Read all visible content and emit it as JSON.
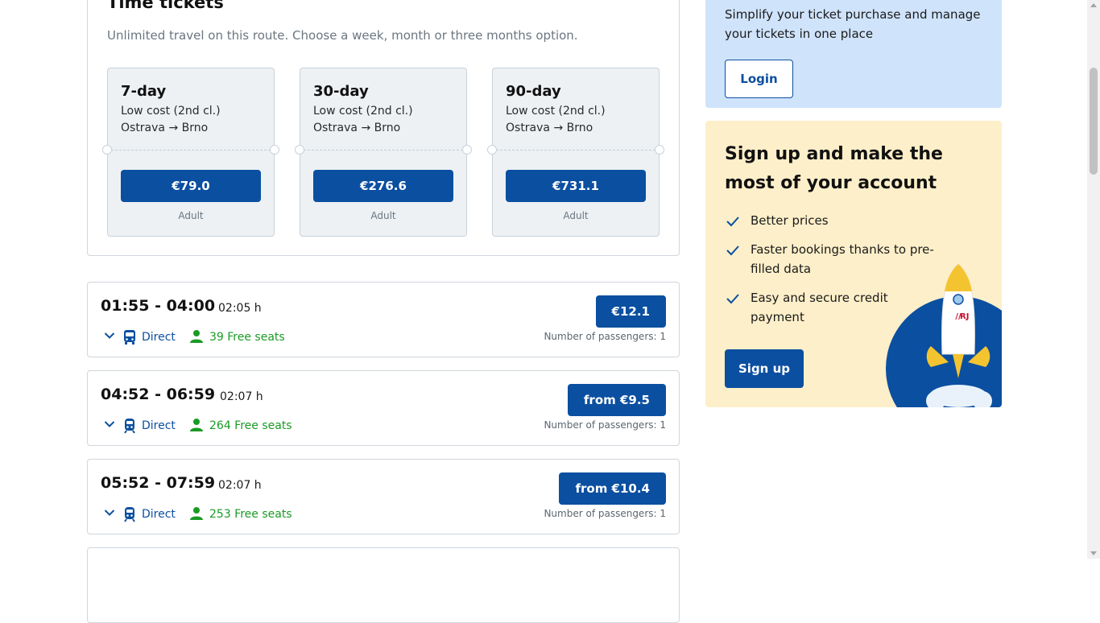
{
  "time_tickets": {
    "title": "Time tickets",
    "subtitle": "Unlimited travel on this route. Choose a week, month or three months option.",
    "tickets": [
      {
        "name": "7-day",
        "class": "Low cost (2nd cl.)",
        "route": "Ostrava → Brno",
        "price": "€79.0",
        "category": "Adult"
      },
      {
        "name": "30-day",
        "class": "Low cost (2nd cl.)",
        "route": "Ostrava → Brno",
        "price": "€276.6",
        "category": "Adult"
      },
      {
        "name": "90-day",
        "class": "Low cost (2nd cl.)",
        "route": "Ostrava → Brno",
        "price": "€731.1",
        "category": "Adult"
      }
    ]
  },
  "connections": [
    {
      "times": "01:55 - 04:00",
      "duration": "02:05 h",
      "vehicle_icon": "bus-icon",
      "type": "Direct",
      "seats": "39 Free seats",
      "price": "€12.1",
      "passengers": "Number of passengers: 1"
    },
    {
      "times": "04:52 - 06:59",
      "duration": "02:07 h",
      "vehicle_icon": "train-icon",
      "type": "Direct",
      "seats": "264 Free seats",
      "price": "from €9.5",
      "passengers": "Number of passengers: 1"
    },
    {
      "times": "05:52 - 07:59",
      "duration": "02:07 h",
      "vehicle_icon": "train-icon",
      "type": "Direct",
      "seats": "253 Free seats",
      "price": "from €10.4",
      "passengers": "Number of passengers: 1"
    }
  ],
  "login_box": {
    "text": "Simplify your ticket purchase and manage your tickets in one place",
    "button": "Login"
  },
  "signup_box": {
    "title": "Sign up and make the most of your account",
    "benefits": [
      "Better prices",
      "Faster bookings thanks to pre-filled data",
      "Easy and secure credit payment"
    ],
    "button": "Sign up",
    "rocket_logo_text": "RJ"
  },
  "colors": {
    "primary": "#0b4fa0",
    "success": "#1a9a24",
    "login_bg": "#cfe3fb",
    "signup_bg": "#fdefc9",
    "ticket_bg": "#edf1f4"
  }
}
